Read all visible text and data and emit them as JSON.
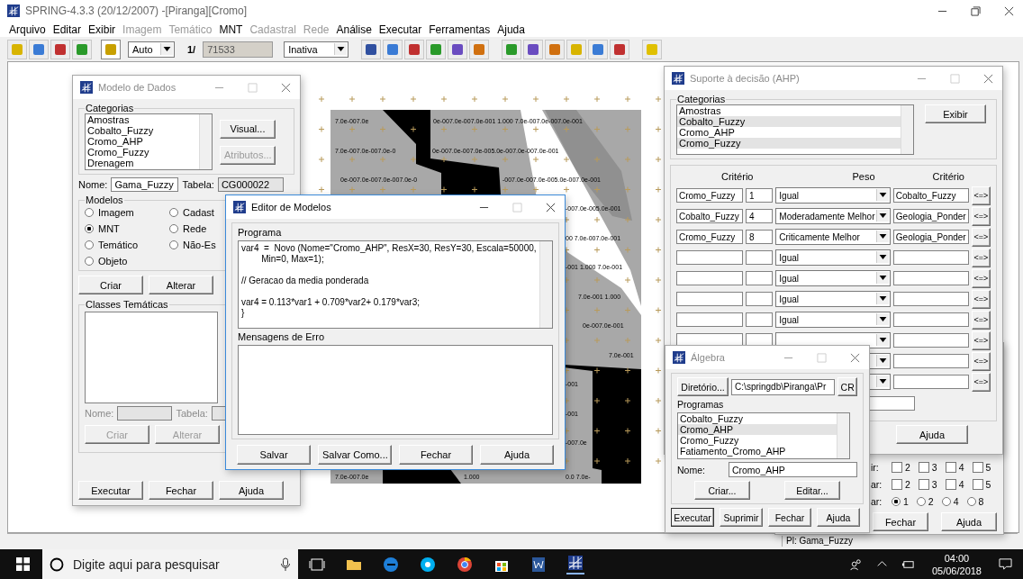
{
  "app": {
    "title": "SPRING-4.3.3 (20/12/2007) -[Piranga][Cromo]",
    "menu": [
      {
        "label": "Arquivo",
        "disabled": false
      },
      {
        "label": "Editar",
        "disabled": false
      },
      {
        "label": "Exibir",
        "disabled": false
      },
      {
        "label": "Imagem",
        "disabled": true
      },
      {
        "label": "Temático",
        "disabled": true
      },
      {
        "label": "MNT",
        "disabled": false
      },
      {
        "label": "Cadastral",
        "disabled": true
      },
      {
        "label": "Rede",
        "disabled": true
      },
      {
        "label": "Análise",
        "disabled": false
      },
      {
        "label": "Executar",
        "disabled": false
      },
      {
        "label": "Ferramentas",
        "disabled": false
      },
      {
        "label": "Ajuda",
        "disabled": false
      }
    ],
    "toolbar": {
      "scale_mode": "Auto",
      "scale_prefix": "1/",
      "scale": "71533",
      "mode": "Inativa"
    },
    "status_bar": "Pl: Gama_Fuzzy"
  },
  "map": {
    "labels": [
      "7.0e-007.0e",
      "0e-007.0e-007.0e-001 1.000 7.0e-007.0e-007.0e-001",
      "7.0e-007.0e-007.0e-0",
      "0e-007.0e-007.0e-005.0e-007.0e-007.0e-001",
      "0e-007.0e-007.0e-007.0e-0",
      "-007.0e-007.0e-005.0e-007.0e-001",
      "-007.0e-005.0e-001",
      "00 7.0e-007.0e-001",
      "-001 1.000 7.0e-001",
      "7.0e-001 1.000",
      "0e-007.0e-001",
      "7.0e-001",
      "-001",
      "-001",
      "-007.0e",
      "7.0e-007.0e",
      "1.000",
      "0.0 7.0e-"
    ]
  },
  "modelo_dados": {
    "title": "Modelo de Dados",
    "active": false,
    "categorias_label": "Categorias",
    "categorias": [
      "Amostras",
      "Cobalto_Fuzzy",
      "Cromo_AHP",
      "Cromo_Fuzzy",
      "Drenagem"
    ],
    "visual_button": {
      "label": "Visual...",
      "disabled": false
    },
    "atributos_button": {
      "label": "Atributos...",
      "disabled": true
    },
    "nome_label": "Nome:",
    "nome": "Gama_Fuzzy",
    "tabela_label": "Tabela:",
    "tabela": "CG000022",
    "modelos_label": "Modelos",
    "modelos": [
      {
        "label": "Imagem",
        "selected": false
      },
      {
        "label": "Cadast",
        "selected": false
      },
      {
        "label": "MNT",
        "selected": true
      },
      {
        "label": "Rede",
        "selected": false
      },
      {
        "label": "Temático",
        "selected": false
      },
      {
        "label": "Não-Es",
        "selected": false
      },
      {
        "label": "Objeto",
        "selected": false
      }
    ],
    "modelo_buttons": [
      "Criar",
      "Alterar"
    ],
    "classes": {
      "label": "Classes Temáticas",
      "disabled": true,
      "nome_label": "Nome:",
      "tabela_label": "Tabela:",
      "buttons": [
        "Criar",
        "Alterar"
      ]
    },
    "buttons": [
      "Executar",
      "Fechar",
      "Ajuda"
    ]
  },
  "editor": {
    "title": "Editor de Modelos",
    "active": true,
    "programa_label": "Programa",
    "code": [
      [
        "var4  =  Novo (Nome=\"Cromo_AHP\", ResX=30, ResY=30, Escala=50000,",
        "        Min=0, Max=1);"
      ],
      [
        "// Geracao da media ponderada"
      ],
      [
        "var4 = 0.113*var1 + 0.709*var2+ 0.179*var3;",
        "}"
      ]
    ],
    "erros_label": "Mensagens de Erro",
    "buttons": [
      "Salvar",
      "Salvar Como...",
      "Fechar",
      "Ajuda"
    ]
  },
  "ahp": {
    "title": "Suporte à decisão (AHP)",
    "active": false,
    "categorias_label": "Categorias",
    "categorias": [
      {
        "label": "Amostras",
        "selected": false
      },
      {
        "label": "Cobalto_Fuzzy",
        "selected": true
      },
      {
        "label": "Cromo_AHP",
        "selected": false
      },
      {
        "label": "Cromo_Fuzzy",
        "selected": true
      }
    ],
    "exibir_button": "Exibir",
    "headers": [
      "Critério",
      "Peso",
      "Critério"
    ],
    "rows": [
      {
        "criterio_a": "Cromo_Fuzzy",
        "valor": "1",
        "peso": "Igual",
        "criterio_b": "Cobalto_Fuzzy",
        "swap": "<=>"
      },
      {
        "criterio_a": "Cobalto_Fuzzy",
        "valor": "4",
        "peso": "Moderadamente Melhor",
        "criterio_b": "Geologia_Ponder",
        "swap": "<=>"
      },
      {
        "criterio_a": "Cromo_Fuzzy",
        "valor": "8",
        "peso": "Criticamente Melhor",
        "criterio_b": "Geologia_Ponder",
        "swap": "<=>"
      },
      {
        "peso": "Igual",
        "swap": "<=>"
      },
      {
        "peso": "Igual",
        "swap": "<=>"
      },
      {
        "peso": "Igual",
        "swap": "<=>"
      },
      {
        "peso": "Igual",
        "swap": "<=>"
      },
      {
        "swap": "<=>"
      },
      {
        "swap": "<=>"
      },
      {
        "swap": "<=>"
      }
    ],
    "ajuda_button": "Ajuda"
  },
  "janela_fundo": {
    "rows": [
      {
        "label": "ir:",
        "kind": "checkbox",
        "options": [
          {
            "label": "2",
            "checked": false
          },
          {
            "label": "3",
            "checked": false
          },
          {
            "label": "4",
            "checked": false
          },
          {
            "label": "5",
            "checked": false
          }
        ]
      },
      {
        "label": "ar:",
        "kind": "checkbox",
        "options": [
          {
            "label": "2",
            "checked": false
          },
          {
            "label": "3",
            "checked": false
          },
          {
            "label": "4",
            "checked": false
          },
          {
            "label": "5",
            "checked": false
          }
        ]
      },
      {
        "label": "ar:",
        "kind": "radio",
        "options": [
          {
            "label": "1",
            "checked": true
          },
          {
            "label": "2",
            "checked": false
          },
          {
            "label": "4",
            "checked": false
          },
          {
            "label": "8",
            "checked": false
          }
        ]
      }
    ],
    "buttons": [
      "Fechar",
      "Ajuda"
    ]
  },
  "algebra": {
    "title": "Álgebra",
    "active": false,
    "diretorio_button": "Diretório...",
    "diretorio": "C:\\springdb\\Piranga\\Pr",
    "cr_button": "CR",
    "programas_label": "Programas",
    "programas": [
      {
        "label": "Cobalto_Fuzzy",
        "selected": false
      },
      {
        "label": "Cromo_AHP",
        "selected": true
      },
      {
        "label": "Cromo_Fuzzy",
        "selected": false
      },
      {
        "label": "Fatiamento_Cromo_AHP",
        "selected": false
      }
    ],
    "nome_label": "Nome:",
    "nome": "Cromo_AHP",
    "mid_buttons": [
      "Criar...",
      "Editar..."
    ],
    "buttons": [
      "Executar",
      "Suprimir",
      "Fechar",
      "Ajuda"
    ]
  },
  "taskbar": {
    "search_placeholder": "Digite aqui para pesquisar",
    "time": "04:00",
    "date": "05/06/2018"
  }
}
